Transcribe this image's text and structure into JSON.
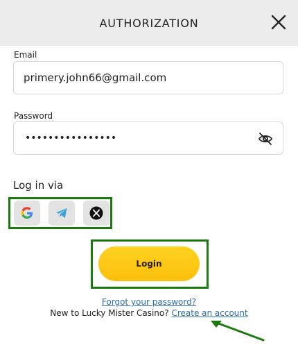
{
  "header": {
    "title": "AUTHORIZATION"
  },
  "email": {
    "label": "Email",
    "value": "primery.john66@gmail.com"
  },
  "password": {
    "label": "Password",
    "masked_value": "••••••••••••••••"
  },
  "social": {
    "label": "Log in via",
    "providers": [
      {
        "name": "google-icon"
      },
      {
        "name": "telegram-icon"
      },
      {
        "name": "x-icon"
      }
    ]
  },
  "login_button": {
    "label": "Login"
  },
  "footer": {
    "forgot_link": "Forgot your password?",
    "new_prefix": "New to Lucky Mister Casino?",
    "create_link": "Create an account"
  },
  "colors": {
    "highlight_border": "#1a7a0e",
    "login_button": "#fbbf0d",
    "link": "#2d6fb0",
    "header_bg": "#ececec"
  }
}
